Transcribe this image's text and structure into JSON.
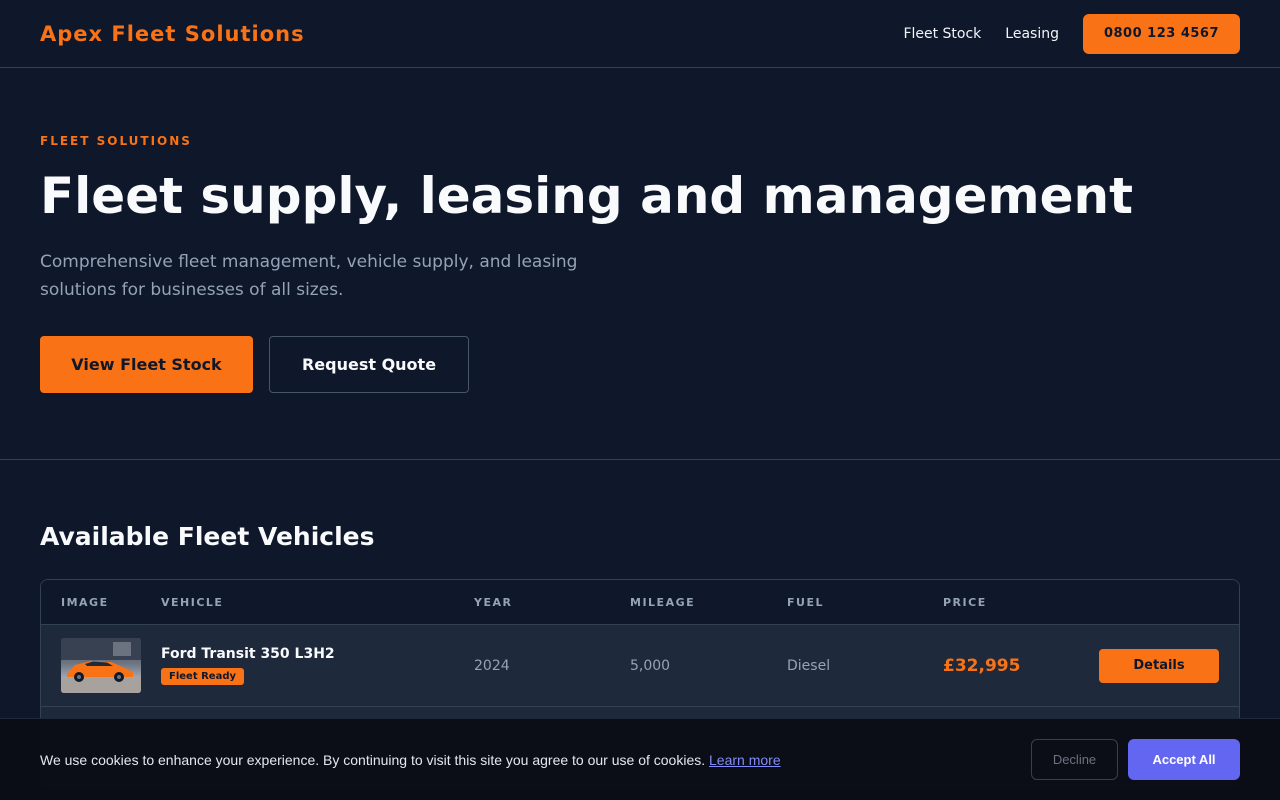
{
  "header": {
    "brand": "Apex Fleet Solutions",
    "nav": [
      "Fleet Stock",
      "Leasing"
    ],
    "phone": "0800 123 4567"
  },
  "hero": {
    "eyebrow": "FLEET SOLUTIONS",
    "title": "Fleet supply, leasing and management",
    "subtitle": "Comprehensive fleet management, vehicle supply, and leasing solutions for businesses of all sizes.",
    "primary_cta": "View Fleet Stock",
    "secondary_cta": "Request Quote"
  },
  "vehicles": {
    "title": "Available Fleet Vehicles",
    "columns": [
      "IMAGE",
      "VEHICLE",
      "YEAR",
      "MILEAGE",
      "FUEL",
      "PRICE"
    ],
    "rows": [
      {
        "name": "Ford Transit 350 L3H2",
        "badge": "Fleet Ready",
        "year": "2024",
        "mileage": "5,000",
        "fuel": "Diesel",
        "price": "£32,995",
        "action": "Details"
      }
    ]
  },
  "cookie": {
    "text": "We use cookies to enhance your experience. By continuing to visit this site you agree to our use of cookies.",
    "link": "Learn more",
    "decline": "Decline",
    "accept": "Accept All"
  },
  "colors": {
    "background": "#0f172a",
    "accent": "#f97316",
    "accept": "#6366f1"
  }
}
